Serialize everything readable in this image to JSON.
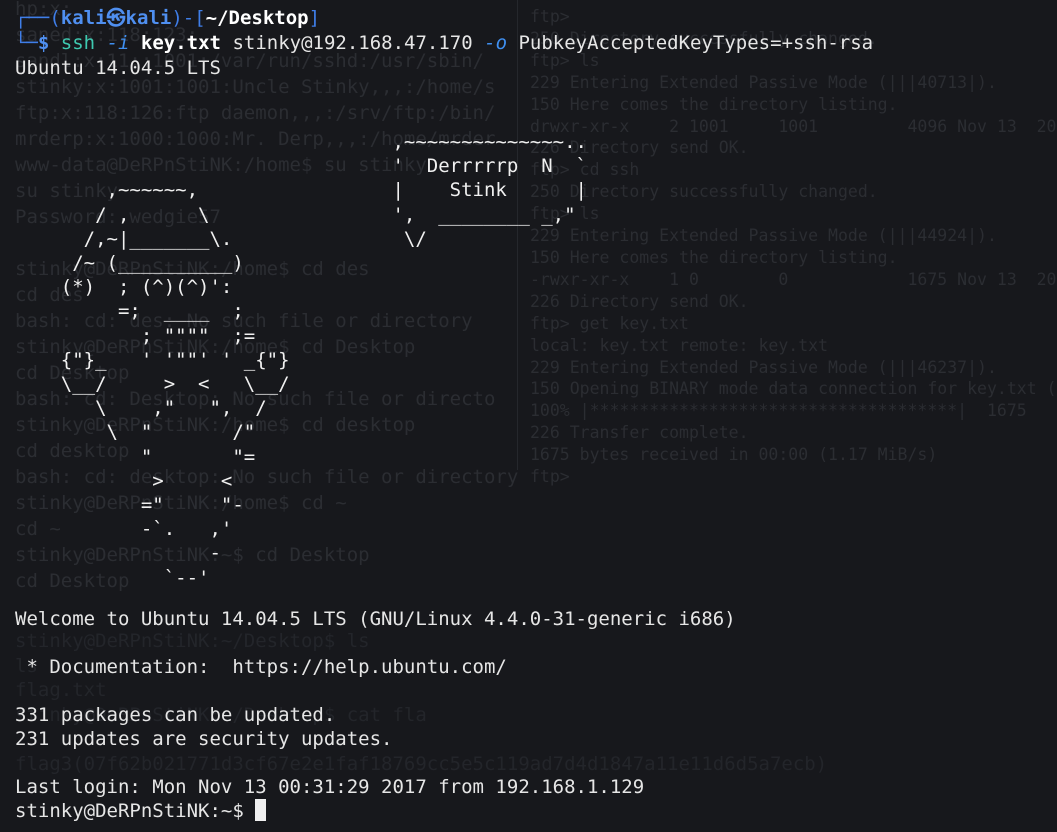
{
  "background_ghost": {
    "left": "hp:x:\nsaned:x:118:123:\nsandl:x:11::1001:/var/run/sshd:/usr/sbin/\nstinky:x:1001:1001:Uncle Stinky,,,:/home/s\nftp:x:118:126:ftp daemon,,,:/srv/ftp:/bin/\nmrderp:x:1000:1000:Mr. Derp,,,:/home/mrder\nwww-data@DeRPnStiNK:/home$ su stinky\nsu stinky\nPassword: wedgie57\n\nstinky@DeRPnStiNK:/home$ cd des\ncd des\nbash: cd: des: No such file or directory\nstinky@DeRPnStiNK:/home$ cd Desktop\ncd Desktop\nbash: cd: Desktop: No such file or directo\nstinky@DeRPnStiNK:/home$ cd desktop\ncd desktop\nbash: cd: desktop: No such file or directory\nstinky@DeRPnStiNK:/home$ cd ~\ncd ~\nstinky@DeRPnStiNK:~$ cd Desktop\ncd Desktop",
    "right": "ftp> \n250 Directory successfully changed.\nftp> ls\n229 Entering Extended Passive Mode (|||40713|).\n150 Here comes the directory listing.\ndrwxr-xr-x    2 1001     1001         4096 Nov 13  2017\n226 Directory send OK.\nftp> cd ssh\n250 Directory successfully changed.\nftp> ls\n229 Entering Extended Passive Mode (|||44924|).\n150 Here comes the directory listing.\n-rwxr-xr-x    1 0        0            1675 Nov 13  2017\n226 Directory send OK.\nftp> get key.txt\nlocal: key.txt remote: key.txt\n229 Entering Extended Passive Mode (|||46237|).\n150 Opening BINARY mode data connection for key.txt (1675\n100% |*************************************|  1675\n226 Transfer complete.\n1675 bytes received in 00:00 (1.17 MiB/s)\nftp> ",
    "bottom": "stinky@DeRPnStiNK:~/Desktop$ ls\nls\nflag.txt\nstinky@DeRPnStiNK:~/Desktop$ cat fla\n\nflag3(07f62b021771d3cf67e2e1faf18769cc5e5c119ad7d4d1847a11e11d6d5a7ecb)"
  },
  "prompt": {
    "corner_top": "┌──(",
    "user": "kali",
    "at_symbol": "㉿",
    "host": "kali",
    "sep": ")-[",
    "path": "~/Desktop",
    "close": "]",
    "corner_bottom": "└─",
    "dollar": "$"
  },
  "command": {
    "program": "ssh",
    "flag_i": "-i",
    "keyfile": "key.txt",
    "target": "stinky@192.168.47.170",
    "flag_o": "-o",
    "option": "PubkeyAcceptedKeyTypes=+ssh-rsa"
  },
  "banner_top": "Ubuntu 14.04.5 LTS",
  "ascii_art": "                                 ,~~~~~~~~~~~~~~..\n                                 '  Derrrrrp  N  `\n        ,~~~~~~,                 |    Stink      |\n       / ,      \\                ',  ________ _,\"\n      /,~|_______\\.               \\/\n     /~ (__________)\n    (*)  ; (^)(^)':\n         =;  ____  ;\n           ; \"\"\"\"  ;=\n    {\"}_   ' '\"\"' ' _{\"}\n    \\__/     >  <   \\__/\n       \\    ,\"   \",  /\n        \\  \"       /\"\n           \"       \"=\n            >     <\n           =\"     \"-\n           -`.   ,'\n                 -\n             `--'",
  "welcome": "Welcome to Ubuntu 14.04.5 LTS (GNU/Linux 4.4.0-31-generic i686)",
  "doc_line": " * Documentation:  https://help.ubuntu.com/",
  "packages_line": "331 packages can be updated.",
  "security_line": "231 updates are security updates.",
  "last_login": "Last login: Mon Nov 13 00:31:29 2017 from 192.168.1.129",
  "final_prompt": "stinky@DeRPnStiNK:~$ ",
  "colors": {
    "background": "#17181c",
    "prompt_blue": "#3f7ee8",
    "command_green": "#3ec9b0",
    "text": "#e6e6e6"
  }
}
